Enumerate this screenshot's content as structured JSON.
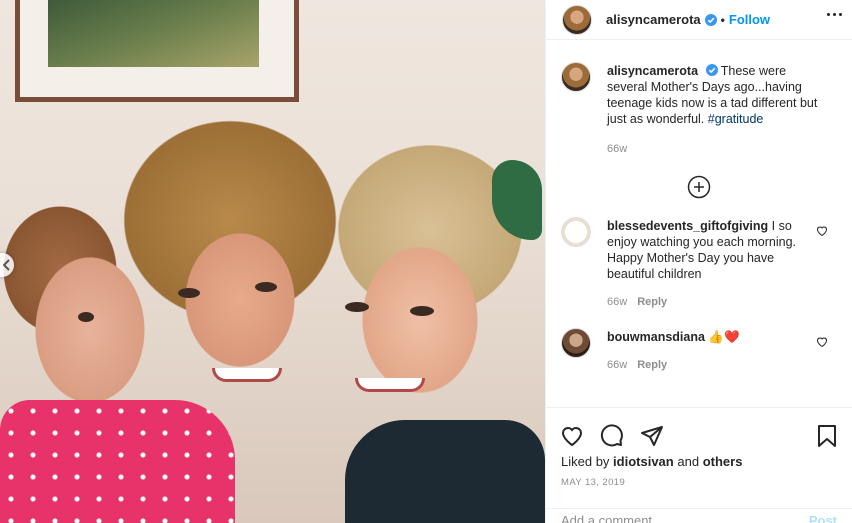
{
  "post": {
    "username": "alisyncamerota",
    "separator": "•",
    "follow_label": "Follow",
    "caption_text": "These were several Mother's Days ago...having teenage kids now is a tad different but just as wonderful.",
    "hashtag": "#gratitude",
    "caption_age": "66w"
  },
  "comments": [
    {
      "username": "blessedevents_giftofgiving",
      "text": "I so enjoy watching you each morning. Happy Mother's Day you have beautiful children",
      "age": "66w",
      "reply_label": "Reply"
    },
    {
      "username": "bouwmansdiana",
      "text": "👍❤️",
      "age": "66w",
      "reply_label": "Reply"
    }
  ],
  "likes": {
    "prefix": "Liked by",
    "first_user": "idiotsivan",
    "and": "and",
    "others": "others"
  },
  "date": "MAY 13, 2019",
  "add_comment": {
    "placeholder": "Add a comment...",
    "post_label": "Post"
  },
  "icons": [
    "more-icon",
    "verified-icon",
    "heart-icon",
    "comment-icon",
    "share-icon",
    "bookmark-icon",
    "load-more-icon",
    "carousel-prev-icon"
  ],
  "colors": {
    "accent": "#0095f6",
    "hashtag": "#00376b",
    "muted": "#8e8e8e",
    "post_disabled": "#b2dffc"
  }
}
